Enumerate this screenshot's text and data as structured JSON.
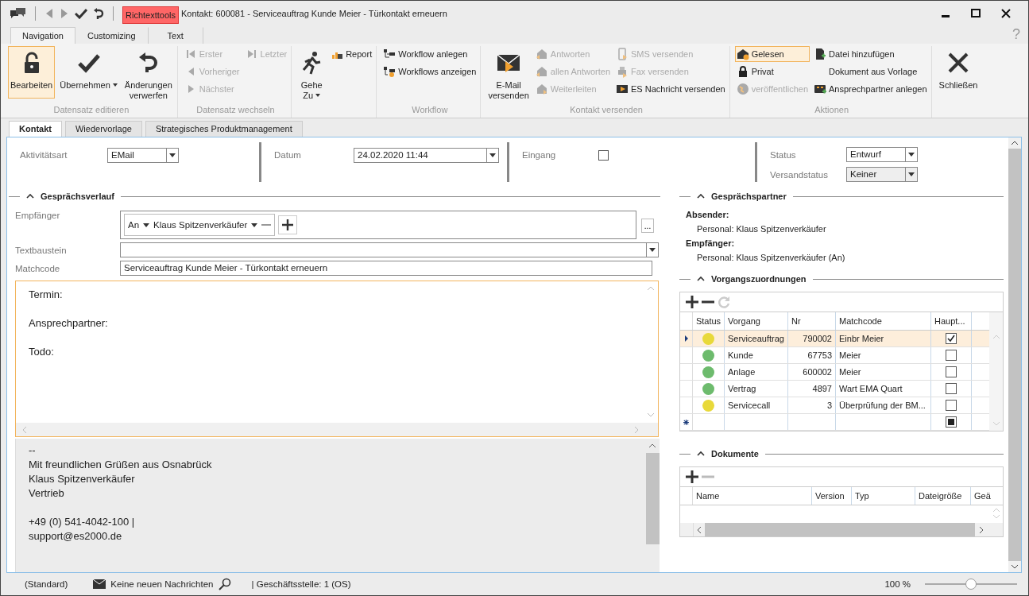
{
  "window": {
    "context_tab": "Richtexttools",
    "title": "Kontakt: 600081 - Serviceauftrag Kunde Meier - Türkontakt erneuern"
  },
  "ribbon_tabs": [
    {
      "label": "Navigation",
      "selected": true
    },
    {
      "label": "Customizing",
      "selected": false
    },
    {
      "label": "Text",
      "selected": false
    }
  ],
  "help": "?",
  "ribbon_groups": [
    {
      "label": "Datensatz editieren",
      "columns": [
        [
          {
            "kind": "large",
            "label": "Bearbeiten",
            "selected": true,
            "disabled": false,
            "dropdown": false
          }
        ],
        [
          {
            "kind": "large",
            "label": "Übernehmen",
            "selected": false,
            "disabled": false,
            "dropdown": true
          }
        ],
        [
          {
            "kind": "large",
            "label": "Änderungen verwerfen",
            "selected": false,
            "disabled": false,
            "dropdown": false
          }
        ]
      ]
    },
    {
      "label": "Datensatz wechseln",
      "columns": [
        [
          {
            "kind": "small",
            "label": "Erster",
            "selected": false,
            "disabled": true
          },
          {
            "kind": "small",
            "label": "Vorheriger",
            "selected": false,
            "disabled": true
          },
          {
            "kind": "small",
            "label": "Nächster",
            "selected": false,
            "disabled": true
          }
        ],
        [
          {
            "kind": "small",
            "label": "Letzter",
            "selected": false,
            "disabled": true
          }
        ]
      ]
    },
    {
      "columns": [
        [
          {
            "kind": "large",
            "label": "Gehe Zu",
            "selected": false,
            "disabled": false,
            "dropdown": true
          }
        ],
        [
          {
            "kind": "small",
            "label": "Report",
            "selected": false,
            "disabled": false
          }
        ]
      ]
    },
    {
      "label": "Workflow",
      "columns": [
        [
          {
            "kind": "small",
            "label": "Workflow anlegen",
            "selected": false,
            "disabled": false
          },
          {
            "kind": "small",
            "label": "Workflows anzeigen",
            "selected": false,
            "disabled": false
          }
        ]
      ]
    },
    {
      "label": "Kontakt versenden",
      "columns": [
        [
          {
            "kind": "large",
            "label": "E-Mail versenden",
            "selected": false,
            "disabled": false,
            "dropdown": false
          }
        ],
        [
          {
            "kind": "small",
            "label": "Antworten",
            "selected": false,
            "disabled": true
          },
          {
            "kind": "small",
            "label": "allen Antworten",
            "selected": false,
            "disabled": true
          },
          {
            "kind": "small",
            "label": "Weiterleiten",
            "selected": false,
            "disabled": true
          }
        ],
        [
          {
            "kind": "small",
            "label": "SMS versenden",
            "selected": false,
            "disabled": true
          },
          {
            "kind": "small",
            "label": "Fax versenden",
            "selected": false,
            "disabled": true
          },
          {
            "kind": "small",
            "label": "ES Nachricht versenden",
            "selected": false,
            "disabled": false
          }
        ]
      ]
    },
    {
      "label": "Aktionen",
      "columns": [
        [
          {
            "kind": "small",
            "label": "Gelesen",
            "selected": true,
            "disabled": false
          },
          {
            "kind": "small",
            "label": "Privat",
            "selected": false,
            "disabled": false
          },
          {
            "kind": "small",
            "label": "veröffentlichen",
            "selected": false,
            "disabled": true
          }
        ],
        [
          {
            "kind": "small",
            "label": "Datei hinzufügen",
            "selected": false,
            "disabled": false
          },
          {
            "kind": "small",
            "label": "Dokument aus Vorlage",
            "selected": false,
            "disabled": false
          },
          {
            "kind": "small",
            "label": "Ansprechpartner anlegen",
            "selected": false,
            "disabled": false
          }
        ]
      ]
    },
    {
      "columns": [
        [
          {
            "kind": "large",
            "label": "Schließen",
            "selected": false,
            "disabled": false,
            "dropdown": false
          }
        ]
      ]
    }
  ],
  "content_tabs": [
    {
      "label": "Kontakt",
      "selected": true
    },
    {
      "label": "Wiedervorlage",
      "selected": false
    },
    {
      "label": "Strategisches Produktmanagement",
      "selected": false
    }
  ],
  "header_groups": [
    [
      {
        "kind": "dropdown",
        "label": "Aktivitätsart",
        "value": "EMail",
        "disabled": false
      }
    ],
    [
      {
        "kind": "dropdown",
        "label": "Datum",
        "value": "24.02.2020 11:44",
        "disabled": false
      }
    ],
    [
      {
        "kind": "checkbox",
        "label": "Eingang",
        "checked": false
      }
    ],
    [
      {
        "kind": "dropdown",
        "label": "Status",
        "value": "Entwurf",
        "disabled": false
      },
      {
        "kind": "dropdown",
        "label": "Versandstatus",
        "value": "Keiner",
        "disabled": true
      }
    ]
  ],
  "conversation": {
    "title": "Gesprächsverlauf",
    "expanded": true,
    "recipients_label": "Empfänger",
    "recipients": [
      {
        "type": "An",
        "name": "Klaus Spitzenverkäufer"
      }
    ],
    "more_button": "...",
    "textbaustein_label": "Textbaustein",
    "matchcode_label": "Matchcode",
    "matchcode": "Serviceauftrag Kunde Meier - Türkontakt erneuern",
    "body": [
      [
        "Termin:"
      ],
      [
        "Ansprechpartner:"
      ],
      [
        "Todo:"
      ]
    ],
    "signature": [
      [
        "--",
        "Mit freundlichen Grüßen aus Osnabrück",
        "Klaus Spitzenverkäufer",
        "Vertrieb"
      ],
      [
        "+49 (0) 541-4042-100 |",
        "support@es2000.de"
      ]
    ]
  },
  "partners": {
    "title": "Gesprächspartner",
    "expanded": true,
    "entries": [
      {
        "heading": "Absender:",
        "value": "Personal: Klaus Spitzenverkäufer"
      },
      {
        "heading": "Empfänger:",
        "value": "Personal: Klaus Spitzenverkäufer (An)"
      }
    ]
  },
  "assignments": {
    "title": "Vorgangszuordnungen",
    "expanded": true,
    "columns": [
      "Status",
      "Vorgang",
      "Nr",
      "Matchcode",
      "Haupt..."
    ],
    "rows": [
      {
        "kind": "row",
        "color": "#e8d93a",
        "vorgang": "Serviceauftrag",
        "nr": "790002",
        "matchcode": "Einbr Meier",
        "checked": true,
        "selected": true
      },
      {
        "kind": "row",
        "color": "#6dbb6d",
        "vorgang": "Kunde",
        "nr": "67753",
        "matchcode": "Meier",
        "checked": false,
        "selected": false
      },
      {
        "kind": "row",
        "color": "#6dbb6d",
        "vorgang": "Anlage",
        "nr": "600002",
        "matchcode": "Meier",
        "checked": false,
        "selected": false
      },
      {
        "kind": "row",
        "color": "#6dbb6d",
        "vorgang": "Vertrag",
        "nr": "4897",
        "matchcode": "Wart EMA Quart",
        "checked": false,
        "selected": false
      },
      {
        "kind": "row",
        "color": "#e8d93a",
        "vorgang": "Servicecall",
        "nr": "3",
        "matchcode": "Überprüfung der BM...",
        "checked": false,
        "selected": false
      },
      {
        "kind": "new",
        "indeterminate": true
      }
    ]
  },
  "documents": {
    "title": "Dokumente",
    "expanded": true,
    "columns": [
      "Name",
      "Version",
      "Typ",
      "Dateigröße",
      "Geä"
    ]
  },
  "status_bar": {
    "items": [
      "(Standard)",
      "Keine neuen Nachrichten",
      "| Geschäftsstelle:  1 (OS)"
    ],
    "zoom": "100 %",
    "level": 0.5
  }
}
